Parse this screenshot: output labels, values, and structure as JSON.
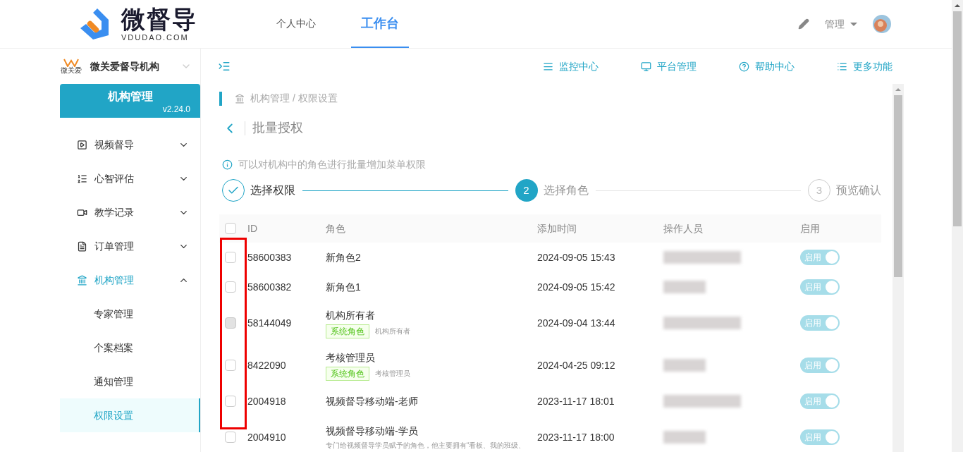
{
  "header": {
    "logo_name": "微督导",
    "logo_domain": "VDUDAO.COM",
    "nav": [
      {
        "label": "个人中心",
        "selected": false
      },
      {
        "label": "工作台",
        "selected": true
      }
    ],
    "user_menu": "管理"
  },
  "sidebar": {
    "org_name": "微关爱督导机构",
    "org_logo_text": "微关爱",
    "title": "机构管理",
    "version": "v2.24.0",
    "items": [
      {
        "label": "视频督导",
        "kind": "play",
        "expanded": false,
        "selected": false
      },
      {
        "label": "心智评估",
        "kind": "list",
        "expanded": false,
        "selected": false
      },
      {
        "label": "教学记录",
        "kind": "video",
        "expanded": false,
        "selected": false
      },
      {
        "label": "订单管理",
        "kind": "doc",
        "expanded": false,
        "selected": false
      },
      {
        "label": "机构管理",
        "kind": "bank",
        "expanded": true,
        "selected": true,
        "children": [
          {
            "label": "专家管理",
            "selected": false
          },
          {
            "label": "个案档案",
            "selected": false
          },
          {
            "label": "通知管理",
            "selected": false
          },
          {
            "label": "权限设置",
            "selected": true
          }
        ]
      }
    ]
  },
  "toolbar": [
    {
      "label": "监控中心",
      "kind": "monitor"
    },
    {
      "label": "平台管理",
      "kind": "screen"
    },
    {
      "label": "帮助中心",
      "kind": "help"
    },
    {
      "label": "更多功能",
      "kind": "list"
    }
  ],
  "breadcrumb": "机构管理 / 权限设置",
  "page_title": "批量授权",
  "info": "可以对机构中的角色进行批量增加菜单权限",
  "steps": [
    {
      "label": "选择权限",
      "kind": "done"
    },
    {
      "number": "2",
      "label": "选择角色",
      "kind": "active"
    },
    {
      "number": "3",
      "label": "预览确认",
      "kind": "pending"
    }
  ],
  "table": {
    "columns": [
      "ID",
      "角色",
      "添加时间",
      "操作人员",
      "启用"
    ],
    "header_checked": false,
    "rows": [
      {
        "id": "58600383",
        "role": "新角色2",
        "time": "2024-09-05 15:43",
        "checked": false,
        "disabled": false,
        "enabled": true,
        "toggle_label": "启用"
      },
      {
        "id": "58600382",
        "role": "新角色1",
        "time": "2024-09-05 15:42",
        "checked": false,
        "disabled": false,
        "enabled": true,
        "toggle_label": "启用"
      },
      {
        "id": "58144049",
        "role": "机构所有者",
        "tag": "系统角色",
        "note": "机构所有者",
        "time": "2024-09-04 13:44",
        "checked": false,
        "disabled": true,
        "enabled": true,
        "toggle_label": "启用"
      },
      {
        "id": "8422090",
        "role": "考核管理员",
        "tag": "系统角色",
        "note": "考核管理员",
        "time": "2024-04-25 09:12",
        "checked": false,
        "disabled": false,
        "enabled": true,
        "toggle_label": "启用"
      },
      {
        "id": "2004918",
        "role": "视频督导移动端-老师",
        "time": "2023-11-17 18:01",
        "checked": false,
        "disabled": false,
        "enabled": true,
        "toggle_label": "启用"
      },
      {
        "id": "2004910",
        "role": "视频督导移动端-学员",
        "description": "专门给视频督导学员赋予的角色，他主要拥有“看板、我的班级、",
        "time": "2023-11-17 18:00",
        "checked": false,
        "disabled": false,
        "enabled": true,
        "toggle_label": "启用"
      }
    ]
  }
}
